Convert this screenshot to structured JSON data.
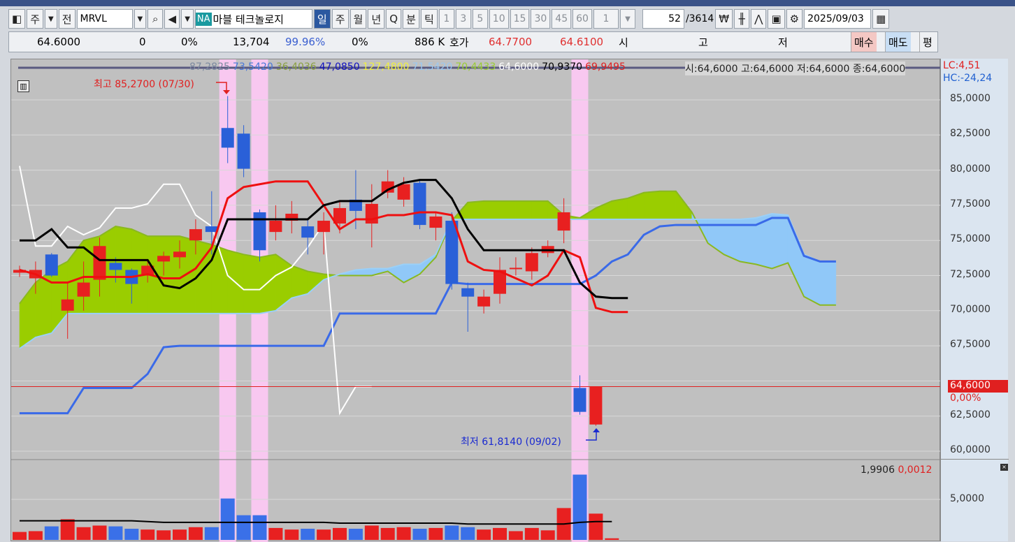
{
  "toolbar": {
    "type": "주",
    "all": "전",
    "symbol": "MRVL",
    "na_badge": "NA",
    "name": "마블 테크놀로지",
    "periods": [
      "일",
      "주",
      "월",
      "년",
      "Q",
      "분",
      "틱"
    ],
    "active_period": "일",
    "minutes": [
      "1",
      "3",
      "5",
      "10",
      "15",
      "30",
      "45",
      "60"
    ],
    "count_value": "1",
    "page": "52",
    "total": "/3614",
    "date": "2025/09/03"
  },
  "quote": {
    "price": "64.6000",
    "change": "0",
    "change_pct": "0%",
    "volume": "13,704",
    "vol_ratio": "99.96%",
    "pct2": "0%",
    "amount": "886 K",
    "hoga_label": "호가",
    "ask": "64.7700",
    "bid": "64.6100",
    "open_label": "시",
    "high_label": "고",
    "low_label": "저",
    "buy": "매수",
    "sell": "매도",
    "avg": "평"
  },
  "legend": {
    "values": [
      {
        "t": "87,2825",
        "c": "#7c8aa0"
      },
      {
        "t": "73,5420",
        "c": "#4a78d8"
      },
      {
        "t": "36,4036",
        "c": "#8aa040"
      },
      {
        "t": "47,0850",
        "c": "#1010c0"
      },
      {
        "t": "127,4800",
        "c": "#f0f040"
      },
      {
        "t": "71,5420",
        "c": "#9cc8f0"
      },
      {
        "t": "70,4433",
        "c": "#9acd32"
      },
      {
        "t": "64,6000",
        "c": "#ffffff"
      },
      {
        "t": "70,9370",
        "c": "#000000"
      },
      {
        "t": "69,9495",
        "c": "#e02020"
      }
    ],
    "ohlc": "시:64,6000 고:64,6000 저:64,6000 종:64,6000",
    "lc": "LC:4,51",
    "hc": "HC:-24,24"
  },
  "annotations": {
    "high": "최고 85,2700 (07/30)",
    "low": "최저 61,8140 (09/02)"
  },
  "price_axis": {
    "labels": [
      "85,0000",
      "82,5000",
      "80,0000",
      "77,5000",
      "75,0000",
      "72,5000",
      "70,0000",
      "67,5000",
      "62,5000",
      "60,0000"
    ],
    "current": "64,6000",
    "current_pct": "0,00%"
  },
  "volume_axis": {
    "label": "5,0000",
    "readout1": "1,9906",
    "readout2": "0,0012"
  },
  "chart_data": {
    "type": "candlestick",
    "ylim": [
      60,
      85
    ],
    "current": 64.6,
    "candles": [
      [
        72.7,
        72.9,
        73.2,
        72.4
      ],
      [
        72.3,
        72.9,
        73.5,
        71.2
      ],
      [
        74.0,
        72.5,
        74.1,
        72.4
      ],
      [
        70.0,
        70.8,
        72.0,
        68.0
      ],
      [
        71.0,
        72.0,
        73.5,
        70.0
      ],
      [
        72.2,
        74.6,
        75.2,
        71.0
      ],
      [
        73.4,
        72.9,
        73.8,
        72.0
      ],
      [
        72.9,
        71.9,
        73.0,
        70.5
      ],
      [
        72.5,
        73.2,
        73.5,
        72.0
      ],
      [
        73.5,
        73.9,
        74.2,
        72.5
      ],
      [
        73.8,
        74.2,
        75.0,
        73.0
      ],
      [
        75.0,
        75.8,
        76.5,
        74.0
      ],
      [
        76.0,
        75.6,
        78.5,
        74.0
      ],
      [
        83.0,
        81.6,
        85.27,
        80.5
      ],
      [
        82.6,
        80.1,
        83.2,
        79.5
      ],
      [
        77.0,
        74.3,
        77.2,
        73.5
      ],
      [
        75.6,
        76.4,
        77.5,
        75.0
      ],
      [
        76.4,
        76.9,
        77.8,
        75.5
      ],
      [
        76.0,
        75.2,
        76.5,
        74.0
      ],
      [
        75.6,
        76.4,
        77.0,
        74.0
      ],
      [
        76.2,
        77.3,
        77.8,
        75.5
      ],
      [
        77.9,
        77.1,
        80.0,
        75.8
      ],
      [
        76.2,
        77.6,
        79.0,
        74.5
      ],
      [
        78.4,
        79.2,
        80.0,
        78.0
      ],
      [
        77.9,
        79.0,
        79.5,
        77.4
      ],
      [
        79.1,
        76.1,
        79.3,
        75.8
      ],
      [
        75.9,
        76.7,
        77.0,
        75.0
      ],
      [
        76.4,
        71.9,
        77.0,
        71.5
      ],
      [
        71.6,
        71.0,
        72.0,
        68.5
      ],
      [
        70.3,
        71.0,
        71.5,
        69.8
      ],
      [
        71.2,
        72.9,
        73.8,
        70.5
      ],
      [
        73.0,
        73.05,
        73.8,
        72.5
      ],
      [
        72.8,
        74.1,
        74.5,
        72.2
      ],
      [
        74.1,
        74.6,
        75.0,
        73.8
      ],
      [
        75.7,
        77.0,
        78.0,
        74.8
      ],
      [
        64.5,
        62.8,
        65.4,
        62.6
      ],
      [
        61.9,
        64.6,
        64.6,
        61.81
      ]
    ],
    "volume": [
      1.0,
      1.1,
      1.7,
      2.6,
      1.6,
      1.8,
      1.7,
      1.4,
      1.3,
      1.2,
      1.3,
      1.6,
      1.6,
      5.2,
      3.1,
      3.1,
      1.5,
      1.3,
      1.4,
      1.3,
      1.5,
      1.4,
      1.8,
      1.5,
      1.6,
      1.4,
      1.5,
      1.8,
      1.6,
      1.3,
      1.5,
      1.1,
      1.5,
      1.2,
      4.0,
      8.2,
      3.3,
      0.2
    ],
    "volume_ma": [
      2.4,
      2.4,
      2.4,
      2.4,
      2.4,
      2.4,
      2.4,
      2.4,
      2.3,
      2.2,
      2.2,
      2.2,
      2.2,
      2.2,
      2.2,
      2.2,
      2.2,
      2.2,
      2.2,
      2.2,
      2.1,
      2.1,
      2.1,
      2.1,
      2.1,
      2.1,
      2.1,
      2.1,
      2.0,
      2.0,
      2.0,
      2.0,
      2.0,
      2.0,
      2.0,
      2.2,
      2.3,
      2.3
    ],
    "highlight_idx": [
      13,
      15,
      35
    ],
    "conversion": [
      72.9,
      72.6,
      72.0,
      72.0,
      72.4,
      72.4,
      72.4,
      72.4,
      72.6,
      72.3,
      72.3,
      73.0,
      74.5,
      78.0,
      78.8,
      79.0,
      79.2,
      79.2,
      79.2,
      77.5,
      75.8,
      76.5,
      76.5,
      76.8,
      76.8,
      77.0,
      77.0,
      76.8,
      73.5,
      72.9,
      72.8,
      72.3,
      71.8,
      72.5,
      74.3,
      73.8,
      70.2,
      69.9,
      69.9
    ],
    "base": [
      75.0,
      75.0,
      75.8,
      74.5,
      74.5,
      73.6,
      73.6,
      73.6,
      73.6,
      71.8,
      71.6,
      72.3,
      73.6,
      76.5,
      76.5,
      76.5,
      76.5,
      76.5,
      76.5,
      77.5,
      77.8,
      77.8,
      77.8,
      78.6,
      79.1,
      79.3,
      79.3,
      78.0,
      75.8,
      74.3,
      74.3,
      74.3,
      74.3,
      74.3,
      74.3,
      72.0,
      71.0,
      70.9,
      70.9
    ],
    "lagging": [
      80.3,
      74.6,
      74.6,
      76.0,
      75.4,
      75.9,
      77.3,
      77.3,
      77.6,
      79.0,
      79.0,
      76.8,
      76.0,
      72.5,
      71.5,
      71.5,
      72.5,
      73.1,
      74.5,
      76.2,
      62.7,
      64.6,
      64.6
    ],
    "span_a": [
      70.5,
      72.0,
      72.9,
      73.5,
      75.0,
      75.3,
      76.0,
      75.8,
      75.3,
      75.3,
      75.3,
      75.0,
      74.7,
      74.3,
      74.0,
      73.8,
      74.0,
      73.2,
      72.8,
      72.6,
      72.5,
      72.5,
      72.5,
      72.8,
      72.0,
      72.6,
      73.8,
      76.4,
      77.7,
      77.8,
      77.8,
      77.8,
      77.8,
      77.8,
      76.8,
      76.6,
      77.3,
      77.8,
      78.0,
      78.4,
      78.5,
      78.5,
      77.0,
      74.8,
      74.0,
      73.5,
      73.3,
      73.0,
      73.4,
      71.0,
      70.4,
      70.4
    ],
    "span_b": [
      67.3,
      68.1,
      68.4,
      69.8,
      69.8,
      69.8,
      69.8,
      69.8,
      69.8,
      69.8,
      69.8,
      69.8,
      69.8,
      69.8,
      69.8,
      69.8,
      70.0,
      70.9,
      71.2,
      72.2,
      72.6,
      72.9,
      73.0,
      73.0,
      73.3,
      73.3,
      74.0,
      76.5,
      76.5,
      76.5,
      76.5,
      76.5,
      76.5,
      76.5,
      76.5,
      76.5,
      76.5,
      76.5,
      76.5,
      76.5,
      76.5,
      76.5,
      76.5,
      76.5,
      76.5,
      76.5,
      76.6,
      76.9,
      76.8,
      74.0,
      73.5,
      73.5
    ],
    "long_line": [
      62.7,
      62.7,
      62.7,
      62.7,
      64.5,
      64.5,
      64.5,
      64.5,
      65.5,
      67.4,
      67.5,
      67.5,
      67.5,
      67.5,
      67.5,
      67.5,
      67.5,
      67.5,
      67.5,
      67.5,
      69.8,
      69.8,
      69.8,
      69.8,
      69.8,
      69.8,
      69.8,
      72.0,
      71.9,
      71.9,
      71.9,
      71.9,
      71.9,
      71.9,
      71.9,
      71.9,
      72.5,
      73.5,
      74.0,
      75.4,
      76.0,
      76.1,
      76.1,
      76.1,
      76.1,
      76.1,
      76.1,
      76.6,
      76.6,
      73.9,
      73.5,
      73.5
    ]
  }
}
